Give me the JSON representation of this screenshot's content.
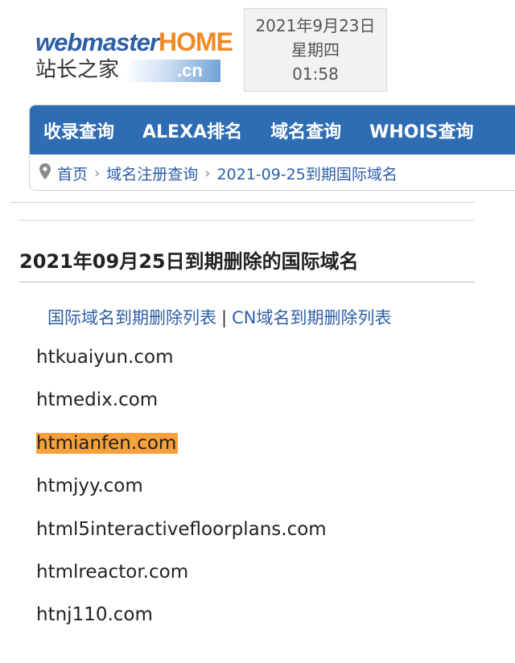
{
  "logo": {
    "top_part1": "webmaster",
    "top_part2": "HOME",
    "cn_text": "站长之家",
    "suffix": ".cn"
  },
  "datebox": {
    "date": "2021年9月23日",
    "weekday": "星期四",
    "time": "01:58"
  },
  "nav": {
    "items": [
      "收录查询",
      "ALEXA排名",
      "域名查询",
      "WHOIS查询"
    ]
  },
  "breadcrumb": {
    "icon": "map-pin-icon",
    "items": [
      "首页",
      "域名注册查询",
      "2021-09-25到期国际域名"
    ],
    "separator": "›"
  },
  "title": "2021年09月25日到期删除的国际域名",
  "links": {
    "intl": "国际域名到期删除列表",
    "divider": "|",
    "cn": "CN域名到期删除列表"
  },
  "domains": [
    "htkuaiyun.com",
    "htmedix.com",
    "htmianfen.com",
    "htmjyy.com",
    "html5interactivefloorplans.com",
    "htmlreactor.com",
    "htnj110.com"
  ],
  "highlight_color": "#f7a13c",
  "accent_color": "#2e6db4"
}
